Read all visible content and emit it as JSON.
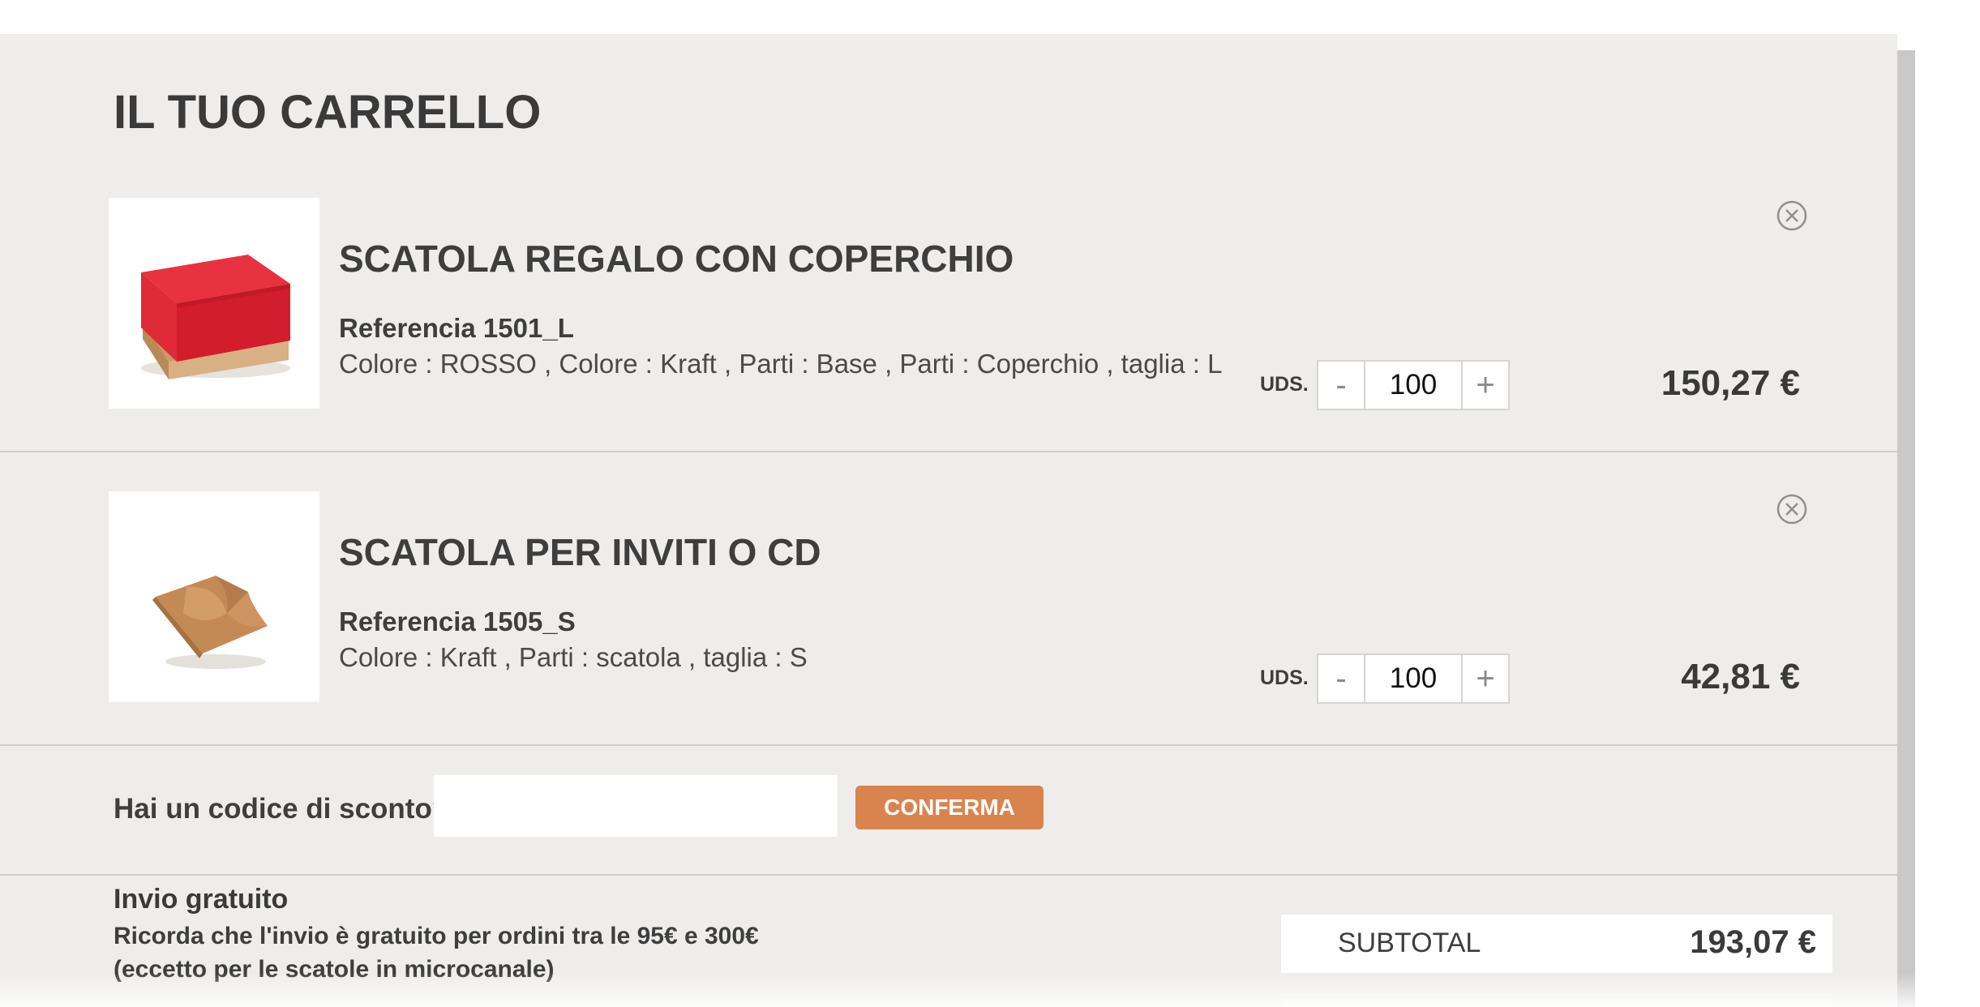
{
  "cart": {
    "title": "IL TUO CARRELLO",
    "items": [
      {
        "name": "SCATOLA REGALO CON COPERCHIO",
        "reference": "Referencia 1501_L",
        "attributes": "Colore : ROSSO , Colore : Kraft , Parti : Base , Parti : Coperchio , taglia : L",
        "qty_label": "UDS.",
        "minus_label": "-",
        "plus_label": "+",
        "quantity": "100",
        "price": "150,27 €",
        "image": "red-gift-box-with-lid",
        "remove_icon": "close-circle-icon"
      },
      {
        "name": "SCATOLA PER INVITI O CD",
        "reference": "Referencia 1505_S",
        "attributes": "Colore : Kraft , Parti : scatola , taglia : S",
        "qty_label": "UDS.",
        "minus_label": "-",
        "plus_label": "+",
        "quantity": "100",
        "price": "42,81 €",
        "image": "kraft-invitation-cd-box",
        "remove_icon": "close-circle-icon"
      }
    ],
    "discount": {
      "label": "Hai un codice di sconto?",
      "input_value": "",
      "input_placeholder": "",
      "button_label": "CONFERMA"
    },
    "shipping": {
      "title": "Invio gratuito",
      "line1": "Ricorda che l'invio è gratuito per ordini tra le 95€ e 300€",
      "line2": "(eccetto per le scatole in microcanale)"
    },
    "subtotal": {
      "label": "SUBTOTAL",
      "value": "193,07 €"
    }
  },
  "colors": {
    "panel_background": "#eeedeb",
    "accent": "#d9844e",
    "text": "#3b3b3b",
    "divider": "#cfcdca"
  }
}
